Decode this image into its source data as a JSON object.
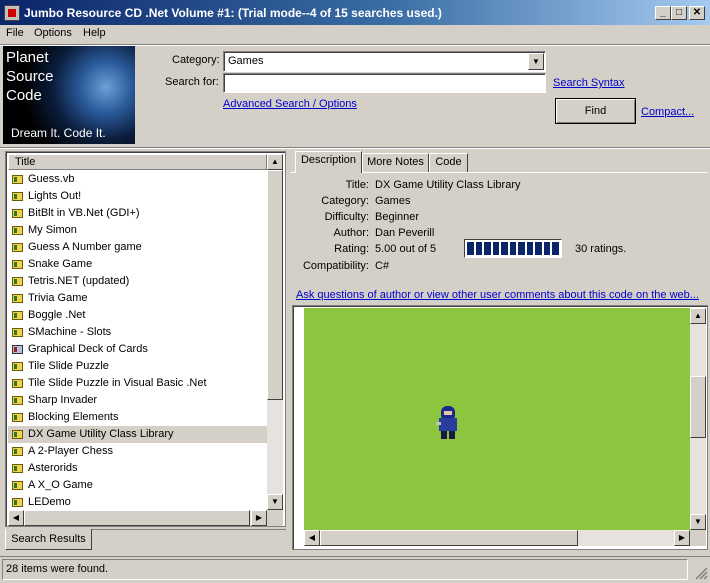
{
  "window": {
    "title": "Jumbo Resource CD .Net Volume #1: (Trial mode--4 of 15 searches used.)",
    "minimize": "_",
    "maximize": "□",
    "close": "✕"
  },
  "menu": [
    {
      "label": "File"
    },
    {
      "label": "Options"
    },
    {
      "label": "Help"
    }
  ],
  "logo": {
    "lines": [
      "Planet",
      "Source",
      "Code"
    ],
    "tagline": "Dream It.  Code It."
  },
  "search": {
    "category_label": "Category:",
    "category_value": "Games",
    "searchfor_label": "Search for:",
    "searchfor_value": "",
    "syntax_link": "Search Syntax",
    "advanced_link": "Advanced Search / Options",
    "find_button": "Find",
    "compact_link": "Compact..."
  },
  "results": {
    "column_header": "Title",
    "items": [
      {
        "label": "Guess.vb",
        "icon": "vb-file-icon"
      },
      {
        "label": "Lights Out!",
        "icon": "vb-file-icon"
      },
      {
        "label": "BitBlt in VB.Net (GDI+)",
        "icon": "vb-file-icon"
      },
      {
        "label": "My Simon",
        "icon": "vb-file-icon"
      },
      {
        "label": "Guess A Number game",
        "icon": "vb-file-icon"
      },
      {
        "label": "Snake Game",
        "icon": "vb-file-icon"
      },
      {
        "label": "Tetris.NET (updated)",
        "icon": "vb-file-icon"
      },
      {
        "label": "Trivia Game",
        "icon": "vb-file-icon"
      },
      {
        "label": "Boggle .Net",
        "icon": "vb-file-icon"
      },
      {
        "label": "SMachine - Slots",
        "icon": "vb-file-icon"
      },
      {
        "label": "Graphical Deck of Cards",
        "icon": "cards-file-icon"
      },
      {
        "label": "Tile Slide Puzzle",
        "icon": "vb-file-icon"
      },
      {
        "label": "Tile Slide Puzzle in Visual Basic .Net",
        "icon": "vb-file-icon"
      },
      {
        "label": "Sharp Invader",
        "icon": "vb-file-icon"
      },
      {
        "label": "Blocking Elements",
        "icon": "vb-file-icon"
      },
      {
        "label": "DX Game Utility Class Library",
        "icon": "vb-file-icon",
        "selected": true
      },
      {
        "label": "A 2-Player Chess",
        "icon": "vb-file-icon"
      },
      {
        "label": "Asterorids",
        "icon": "vb-file-icon"
      },
      {
        "label": "A X_O Game",
        "icon": "vb-file-icon"
      },
      {
        "label": "LEDemo",
        "icon": "vb-file-icon"
      }
    ],
    "tab_label": "Search Results"
  },
  "detail_tabs": [
    {
      "label": "Description",
      "active": true
    },
    {
      "label": "More Notes"
    },
    {
      "label": "Code"
    }
  ],
  "details": {
    "title_label": "Title:",
    "title_value": "DX Game Utility Class Library",
    "category_label": "Category:",
    "category_value": "Games",
    "difficulty_label": "Difficulty:",
    "difficulty_value": "Beginner",
    "author_label": "Author:",
    "author_value": "Dan Peverill",
    "rating_label": "Rating:",
    "rating_value": "5.00 out of 5",
    "rating_fraction": 1.0,
    "rating_count": "30 ratings.",
    "compat_label": "Compatibility:",
    "compat_value": "C#",
    "ask_link": "Ask questions of author or view other user comments about this code on the web..."
  },
  "colors": {
    "preview_bg": "#8cc63f",
    "selection": "#d4d0c8",
    "link": "#0000cc",
    "titlebar_start": "#0a246a"
  },
  "status": {
    "text": "28 items were found."
  }
}
